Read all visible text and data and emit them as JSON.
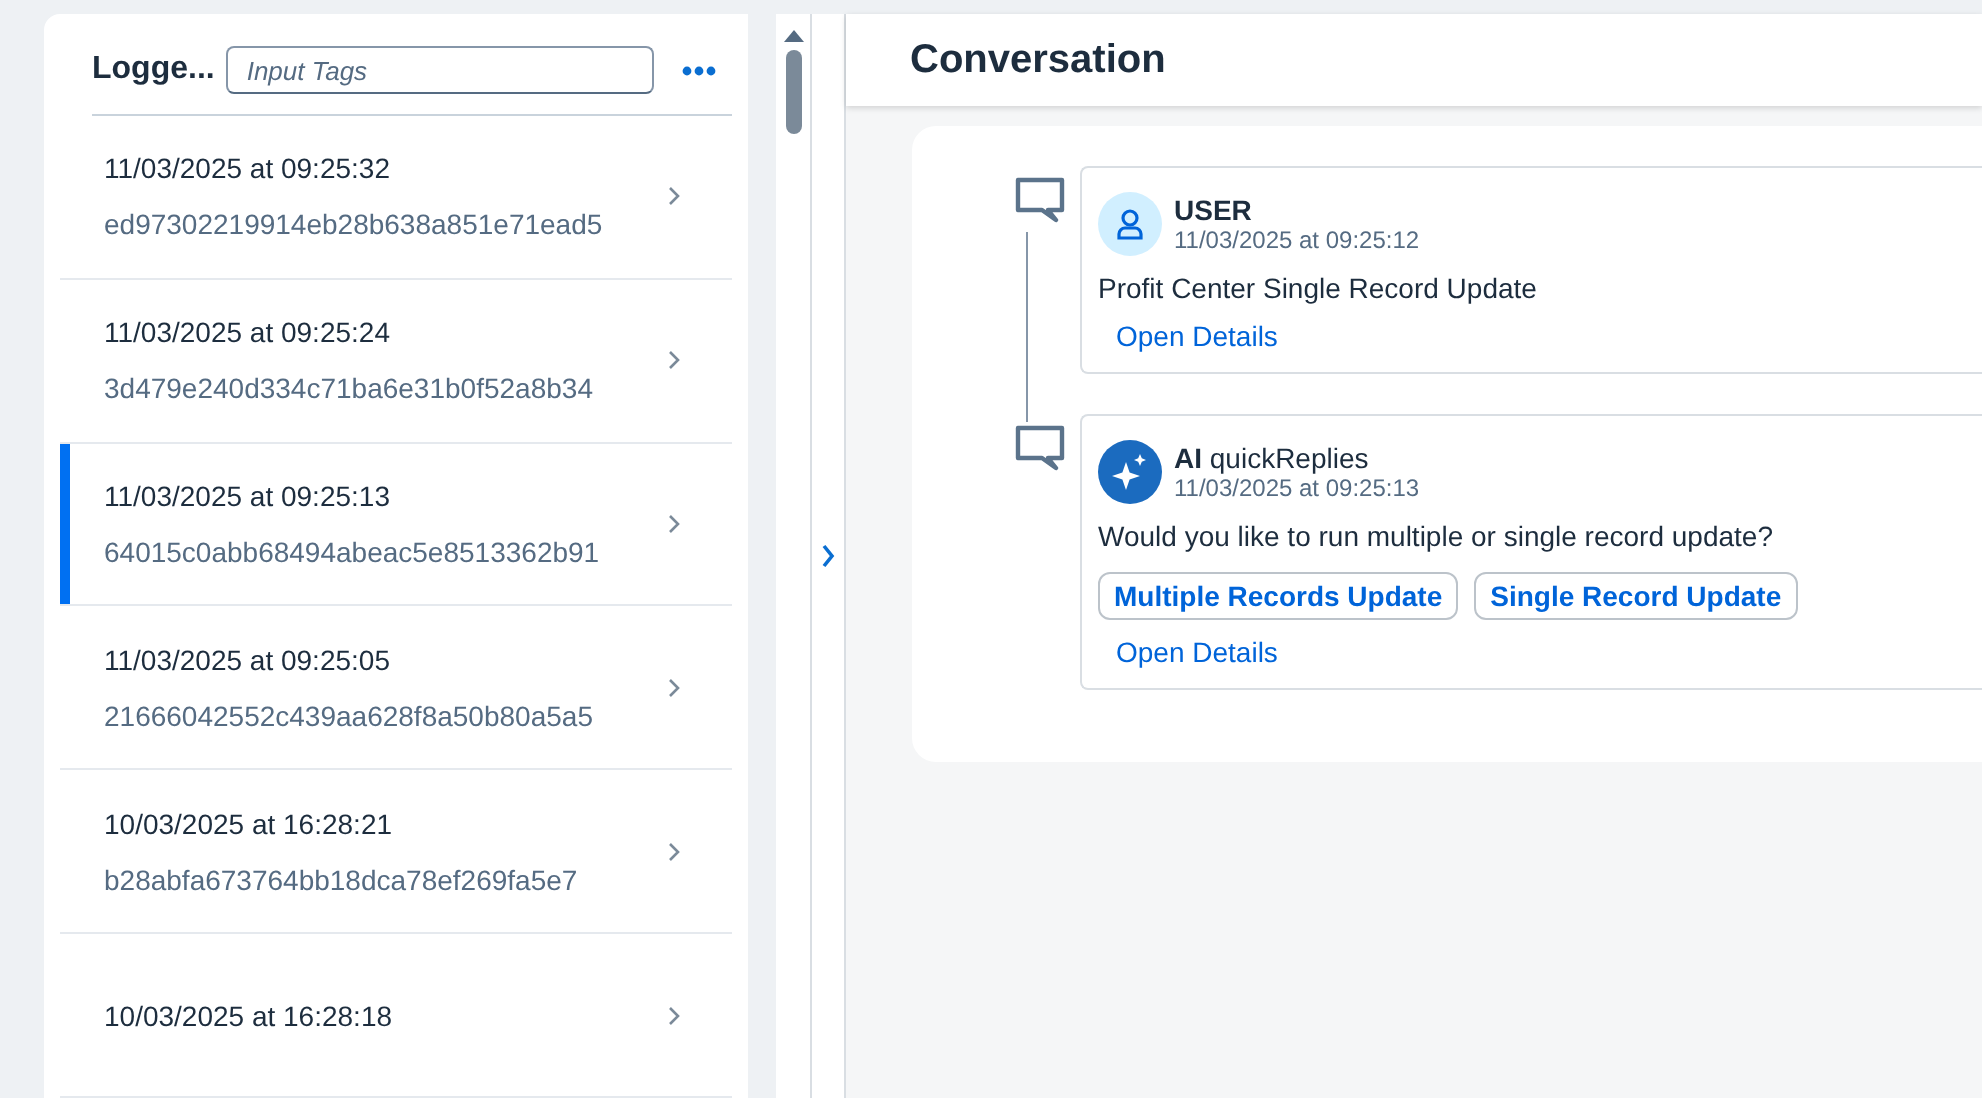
{
  "sidebar": {
    "title": "Logge...",
    "tag_input": {
      "placeholder": "Input Tags"
    },
    "items": [
      {
        "date": "11/03/2025 at 09:25:32",
        "id": "ed97302219914eb28b638a851e71ead5",
        "selected": false
      },
      {
        "date": "11/03/2025 at 09:25:24",
        "id": "3d479e240d334c71ba6e31b0f52a8b34",
        "selected": false
      },
      {
        "date": "11/03/2025 at 09:25:13",
        "id": "64015c0abb68494abeac5e8513362b91",
        "selected": true
      },
      {
        "date": "11/03/2025 at 09:25:05",
        "id": "21666042552c439aa628f8a50b80a5a5",
        "selected": false
      },
      {
        "date": "10/03/2025 at 16:28:21",
        "id": "b28abfa673764bb18dca78ef269fa5e7",
        "selected": false
      },
      {
        "date": "10/03/2025 at 16:28:18",
        "selected": false
      }
    ]
  },
  "conversation": {
    "title": "Conversation",
    "messages": [
      {
        "kind": "user",
        "sender": "USER",
        "time": "11/03/2025 at 09:25:12",
        "text": "Profit Center Single Record Update",
        "link": "Open Details"
      },
      {
        "kind": "ai",
        "sender": "**AI** quickReplies",
        "time": "11/03/2025 at 09:25:13",
        "text": "Would you like to run multiple or single record update?",
        "replies": [
          "Multiple Records Update",
          "Single Record Update"
        ],
        "link": "Open Details"
      }
    ]
  }
}
